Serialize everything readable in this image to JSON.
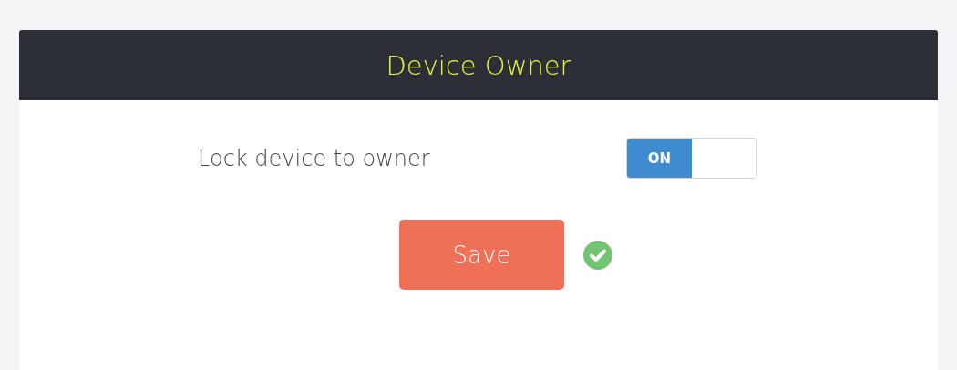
{
  "panel": {
    "title": "Device Owner"
  },
  "setting": {
    "label": "Lock device to owner",
    "toggle": {
      "label": "ON",
      "on": true
    }
  },
  "save_button": {
    "label": "Save"
  },
  "saved": true
}
